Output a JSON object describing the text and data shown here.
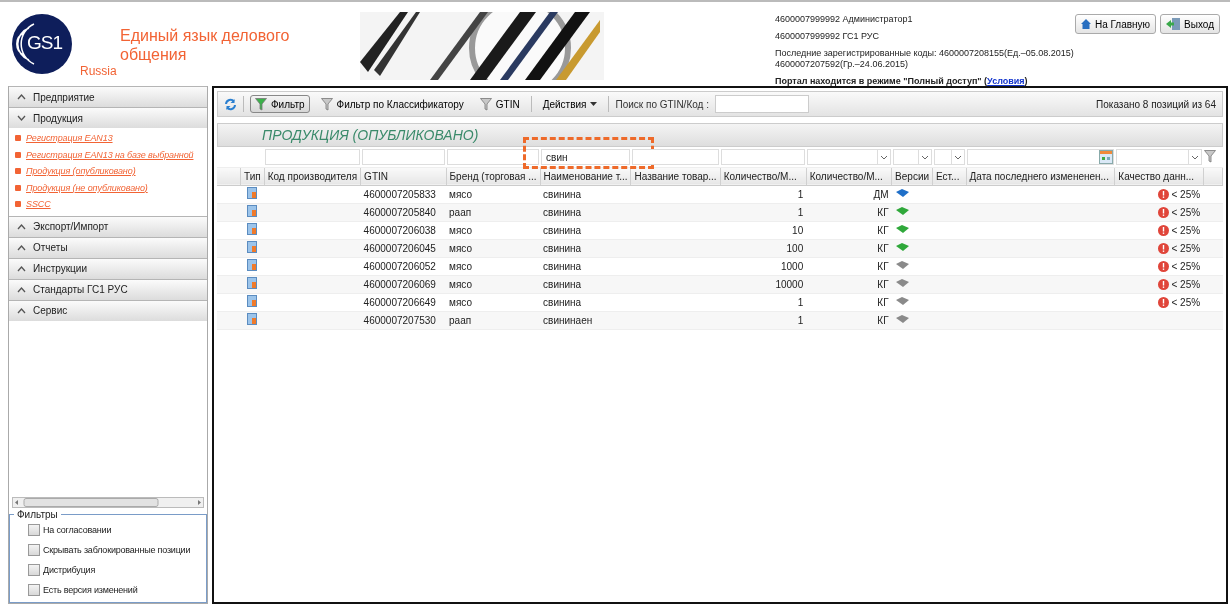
{
  "header": {
    "logo": {
      "mark": "GS1",
      "sub": "Russia"
    },
    "slogan": "Единый язык делового общения",
    "user_lines": [
      "4600007999992 Администратор1",
      "4600007999992 ГС1 РУС"
    ],
    "last_codes": [
      "Последние зарегистрированные коды: 4600007208155(Ед.–05.08.2015)",
      "4600007207592(Гр.–24.06.2015)"
    ],
    "portal_mode": {
      "before": "Портал находится в режиме \"Полный доступ\" (",
      "link": "Условия",
      "after": ")"
    },
    "buttons": [
      {
        "kind": "home",
        "label": "На Главную"
      },
      {
        "kind": "exit",
        "label": "Выход"
      }
    ]
  },
  "sidebar": {
    "sections": [
      {
        "label": "Предприятие",
        "expanded": false
      },
      {
        "label": "Продукция",
        "expanded": true,
        "items": [
          "Регистрация EAN13",
          "Регистрация EAN13 на базе выбранной",
          "Продукция (опубликовано)",
          "Продукция (не опубликовано)",
          "SSCC"
        ]
      },
      {
        "label": "Экспорт/Импорт",
        "expanded": false
      },
      {
        "label": "Отчеты",
        "expanded": false
      },
      {
        "label": "Инструкции",
        "expanded": false
      },
      {
        "label": "Стандарты ГС1 РУС",
        "expanded": false
      },
      {
        "label": "Сервис",
        "expanded": false
      }
    ],
    "filters": {
      "legend": "Фильтры",
      "options": [
        {
          "label": "На согласовании",
          "checked": false
        },
        {
          "label": "Скрывать заблокированные позиции",
          "checked": false
        },
        {
          "label": "Дистрибуция",
          "checked": false
        },
        {
          "label": "Есть версия изменений",
          "checked": false
        }
      ]
    }
  },
  "toolbar": {
    "items": [
      {
        "kind": "refresh"
      },
      {
        "kind": "filter",
        "label": "Фильтр",
        "selected": true
      },
      {
        "kind": "filter",
        "label": "Фильтр по Классификатору",
        "selected": false
      },
      {
        "kind": "filter",
        "label": "GTIN",
        "selected": false
      },
      {
        "kind": "menu",
        "label": "Действия"
      }
    ],
    "search_label": "Поиск по GTIN/Код :",
    "shown": "Показано 8 позиций из 64"
  },
  "grid": {
    "title": "ПРОДУКЦИЯ (ОПУБЛИКОВАНО)",
    "columns": [
      "Тип",
      "Код производителя",
      "GTIN",
      "Бренд (торговая ...",
      "Наименование т...",
      "Название товар...",
      "Количество/М...",
      "Количество/М...",
      "Версии",
      "Ест...",
      "Дата последнего измененен...",
      "Качество данн..."
    ],
    "filters": [
      {
        "kind": "none"
      },
      {
        "kind": "text"
      },
      {
        "kind": "text"
      },
      {
        "kind": "text"
      },
      {
        "kind": "text",
        "value": "свин",
        "highlighted": true
      },
      {
        "kind": "text"
      },
      {
        "kind": "text"
      },
      {
        "kind": "select"
      },
      {
        "kind": "select"
      },
      {
        "kind": "select"
      },
      {
        "kind": "date"
      },
      {
        "kind": "select"
      }
    ],
    "rows": [
      {
        "gtin": "4600007205833",
        "brand": "мясо",
        "name": "свинина",
        "qty": "1",
        "unit": "ДМ",
        "version": {
          "color": "#1f6fc8"
        },
        "quality": "< 25%"
      },
      {
        "gtin": "4600007205840",
        "brand": "раап",
        "name": "свинина",
        "qty": "1",
        "unit": "КГ",
        "version": {
          "color": "#2fa83a"
        },
        "quality": "< 25%"
      },
      {
        "gtin": "4600007206038",
        "brand": "мясо",
        "name": "свинина",
        "qty": "10",
        "unit": "КГ",
        "version": {
          "color": "#2fa83a"
        },
        "quality": "< 25%"
      },
      {
        "gtin": "4600007206045",
        "brand": "мясо",
        "name": "свинина",
        "qty": "100",
        "unit": "КГ",
        "version": {
          "color": "#2fa83a"
        },
        "quality": "< 25%"
      },
      {
        "gtin": "4600007206052",
        "brand": "мясо",
        "name": "свинина",
        "qty": "1000",
        "unit": "КГ",
        "version": {
          "color": "#8a8a8a"
        },
        "quality": "< 25%"
      },
      {
        "gtin": "4600007206069",
        "brand": "мясо",
        "name": "свинина",
        "qty": "10000",
        "unit": "КГ",
        "version": {
          "color": "#8a8a8a"
        },
        "quality": "< 25%"
      },
      {
        "gtin": "4600007206649",
        "brand": "мясо",
        "name": "свинина",
        "qty": "1",
        "unit": "КГ",
        "version": {
          "color": "#8a8a8a"
        },
        "quality": "< 25%"
      },
      {
        "gtin": "4600007207530",
        "brand": "раап",
        "name": "свининаен",
        "qty": "1",
        "unit": "КГ",
        "version": {
          "color": "#8a8a8a"
        }
      }
    ]
  }
}
